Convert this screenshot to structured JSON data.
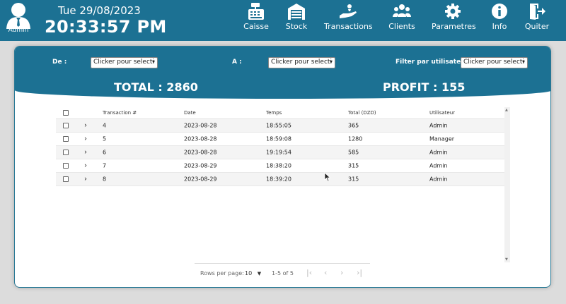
{
  "user": {
    "name": "Admin",
    "icon": "user-icon"
  },
  "date": "Tue 29/08/2023",
  "time": "20:33:57 PM",
  "nav": [
    {
      "label": "Caisse",
      "icon": "cash-register-icon"
    },
    {
      "label": "Stock",
      "icon": "warehouse-icon"
    },
    {
      "label": "Transactions",
      "icon": "hand-money-icon"
    },
    {
      "label": "Clients",
      "icon": "users-icon"
    },
    {
      "label": "Parametres",
      "icon": "gear-icon"
    },
    {
      "label": "Info",
      "icon": "info-icon"
    },
    {
      "label": "Quiter",
      "icon": "exit-icon"
    }
  ],
  "filters": {
    "from_label": "De :",
    "from_value": "Clicker pour selecti",
    "to_label": "A :",
    "to_value": "Clicker pour selecti",
    "user_label": "Filter par utilisateur :",
    "user_value": "Clicker pour selecti"
  },
  "summary": {
    "total": "TOTAL : 2860",
    "profit": "PROFIT : 155"
  },
  "table": {
    "columns": [
      "Transaction #",
      "Date",
      "Temps",
      "Total (DZD)",
      "Utilisateur"
    ],
    "rows": [
      [
        "4",
        "2023-08-28",
        "18:55:05",
        "365",
        "Admin"
      ],
      [
        "5",
        "2023-08-28",
        "18:59:08",
        "1280",
        "Manager"
      ],
      [
        "6",
        "2023-08-28",
        "19:19:54",
        "585",
        "Admin"
      ],
      [
        "7",
        "2023-08-29",
        "18:38:20",
        "315",
        "Admin"
      ],
      [
        "8",
        "2023-08-29",
        "18:39:20",
        "315",
        "Admin"
      ]
    ]
  },
  "pagination": {
    "rows_per_page_label": "Rows per page:",
    "rows_per_page_value": "10",
    "range": "1-5 of 5"
  },
  "colors": {
    "primary": "#1c7193",
    "background": "#dcdcdc"
  }
}
